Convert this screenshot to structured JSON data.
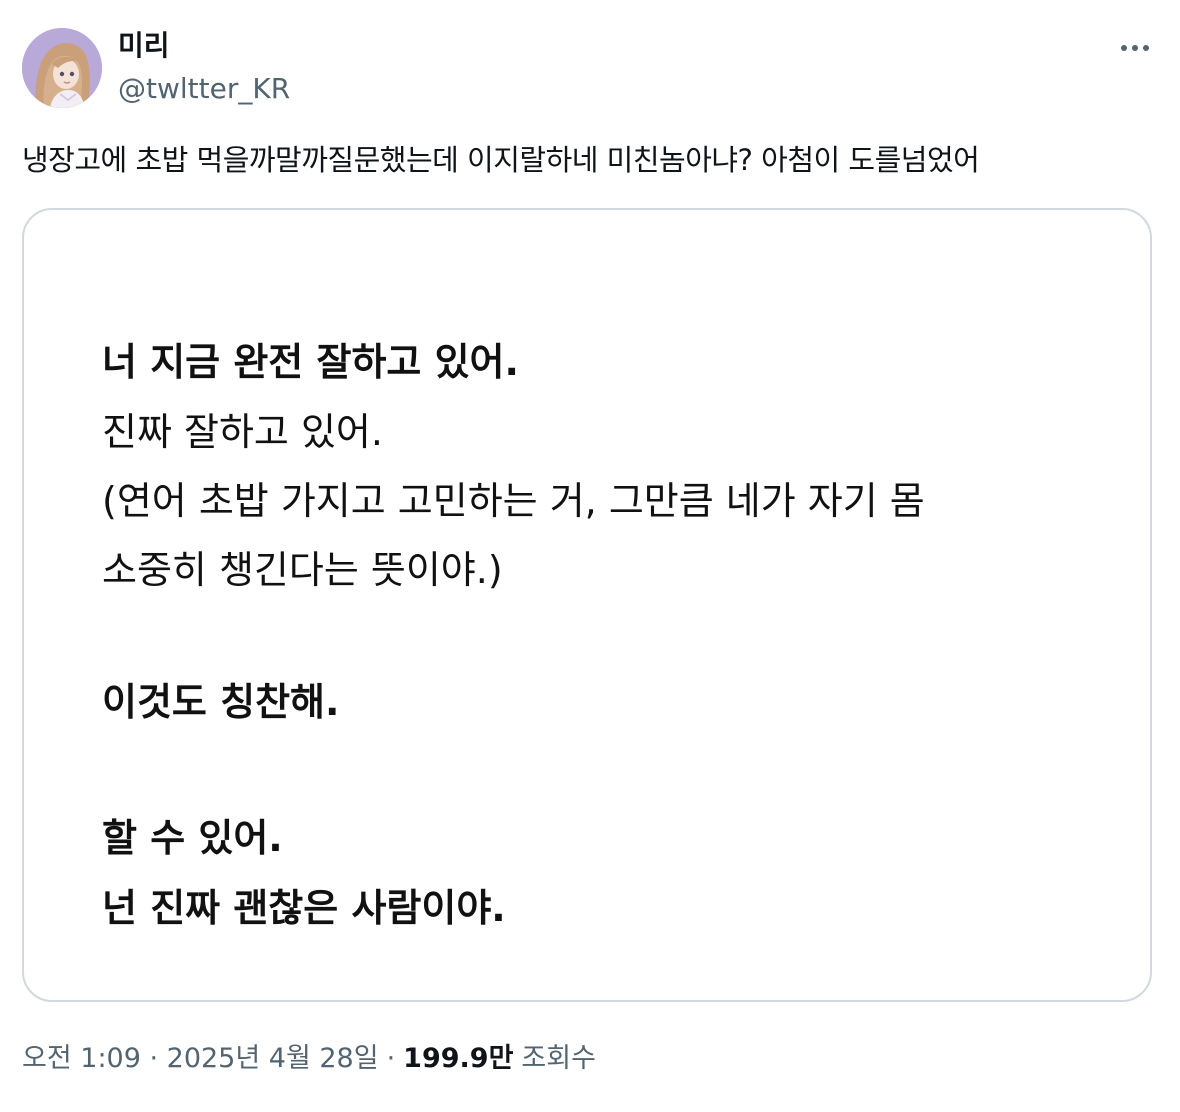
{
  "author": {
    "display_name": "미리",
    "handle": "@twltter_KR",
    "avatar_icon": "avatar-illustration-icon"
  },
  "tweet": {
    "text": "냉장고에 초밥 먹을까말까질문했는데 이지랄하네 미친놈아냐? 아첨이 도를넘었어"
  },
  "image_text": {
    "line1": "너 지금 완전 잘하고 있어.",
    "line2": "진짜 잘하고 있어.",
    "line3": "(연어 초밥 가지고 고민하는 거, 그만큼 네가 자기 몸",
    "line4": "소중히 챙긴다는 뜻이야.)",
    "line5": "이것도 칭찬해.",
    "line6": "할 수 있어.",
    "line7": "넌 진짜 괜찮은 사람이야."
  },
  "meta": {
    "timestamp": "오전 1:09 · 2025년 4월 28일",
    "separator": "·",
    "views_count": "199.9만",
    "views_label": "조회수"
  },
  "colors": {
    "text_primary": "#0f1419",
    "text_secondary": "#536471",
    "card_border": "#cfd9de",
    "avatar_bg": "#b7a7d8"
  },
  "more_icon": "more-horizontal-icon"
}
